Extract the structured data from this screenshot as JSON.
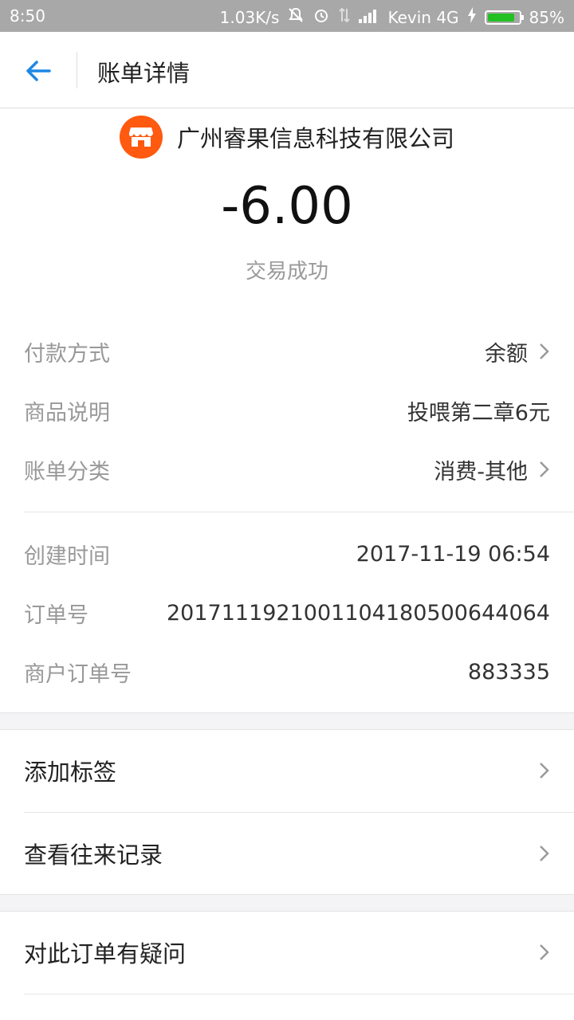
{
  "status_bar": {
    "time": "8:50",
    "net_speed": "1.03K/s",
    "carrier": "Kevin 4G",
    "battery": "85%"
  },
  "nav": {
    "title": "账单详情"
  },
  "merchant": {
    "name": "广州睿果信息科技有限公司",
    "logo_color": "#ff5a10"
  },
  "amount": "-6.00",
  "status": "交易成功",
  "details": {
    "payment_method": {
      "label": "付款方式",
      "value": "余额"
    },
    "description": {
      "label": "商品说明",
      "value": "投喂第二章6元"
    },
    "category": {
      "label": "账单分类",
      "value": "消费-其他"
    },
    "created_time": {
      "label": "创建时间",
      "value": "2017-11-19 06:54"
    },
    "order_no": {
      "label": "订单号",
      "value": "20171119210011041805006440​64"
    },
    "merchant_order_no": {
      "label": "商户订单号",
      "value": "883335"
    }
  },
  "actions": {
    "add_tag": "添加标签",
    "view_history": "查看往来记录",
    "question": "对此订单有疑问"
  },
  "colors": {
    "accent": "#1e88e5",
    "gray_band": "#f4f4f6"
  }
}
